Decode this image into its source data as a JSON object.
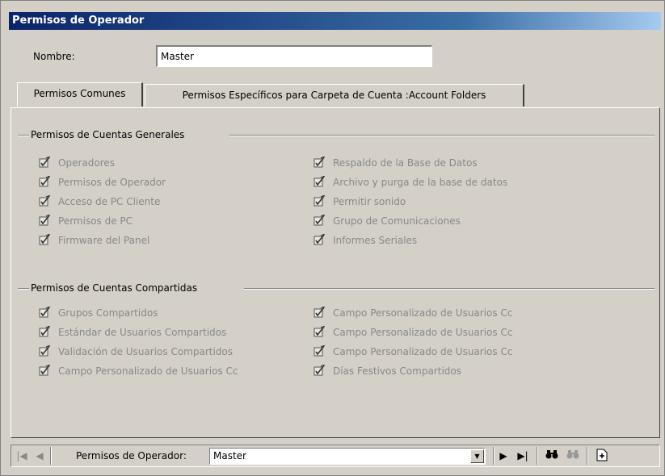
{
  "window": {
    "title": "Permisos de Operador"
  },
  "name": {
    "label": "Nombre:",
    "value": "Master"
  },
  "tabs": [
    {
      "label": "Permisos Comunes",
      "active": true
    },
    {
      "label": "Permisos Específicos para Carpeta de Cuenta :Account Folders",
      "active": false
    }
  ],
  "general": {
    "header": "Permisos de Cuentas Generales",
    "left": [
      "Operadores",
      "Permisos de Operador",
      "Acceso de PC Cliente",
      "Permisos de PC",
      "Firmware del Panel"
    ],
    "right": [
      "Respaldo de la Base de Datos",
      "Archivo y purga de la base de datos",
      "Permitir sonido",
      "Grupo de Comunicaciones",
      "Informes Seriales"
    ]
  },
  "shared": {
    "header": "Permisos de Cuentas Compartidas",
    "left": [
      "Grupos Compartidos",
      "Estándar de Usuarios Compartidos",
      "Validación de Usuarios Compartidos",
      "Campo Personalizado de Usuarios Cc"
    ],
    "right": [
      "Campo Personalizado de Usuarios Cc",
      "Campo Personalizado de Usuarios Cc",
      "Campo Personalizado de Usuarios Cc",
      "Días Festivos Compartidos"
    ]
  },
  "navigator": {
    "label": "Permisos de Operador:",
    "value": "Master"
  },
  "colors": {
    "titlebar_start": "#0a246a",
    "titlebar_end": "#a6caf0",
    "disabled_text": "#888888",
    "face": "#d4d0c8"
  },
  "icons": {
    "checkbox": "checked-pencil-icon",
    "first": "first-record-icon",
    "prev": "prev-record-icon",
    "next": "next-record-icon",
    "last": "last-record-icon",
    "find": "binoculars-icon",
    "find_next": "binoculars-next-icon",
    "new": "new-record-icon"
  }
}
